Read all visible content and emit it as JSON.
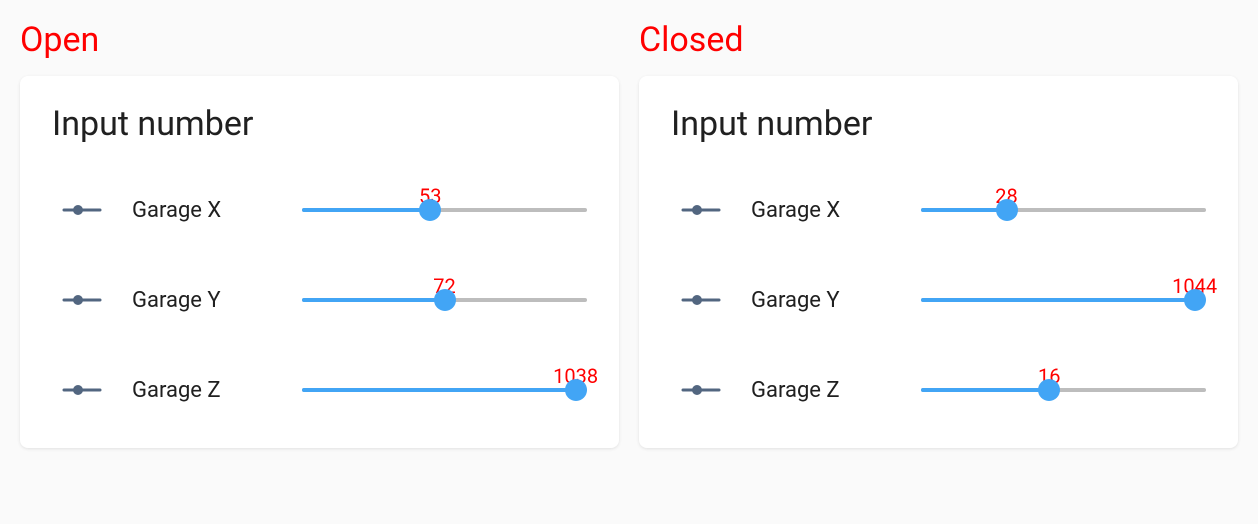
{
  "panels": [
    {
      "title": "Open",
      "card_title": "Input number",
      "rows": [
        {
          "label": "Garage X",
          "value": 53,
          "percent": 45
        },
        {
          "label": "Garage Y",
          "value": 72,
          "percent": 50
        },
        {
          "label": "Garage Z",
          "value": 1038,
          "percent": 96
        }
      ]
    },
    {
      "title": "Closed",
      "card_title": "Input number",
      "rows": [
        {
          "label": "Garage X",
          "value": 28,
          "percent": 30
        },
        {
          "label": "Garage Y",
          "value": 1044,
          "percent": 96
        },
        {
          "label": "Garage Z",
          "value": 16,
          "percent": 45
        }
      ]
    }
  ],
  "colors": {
    "accent": "#42a5f5",
    "danger_text": "#ff0000",
    "icon": "#526680"
  }
}
